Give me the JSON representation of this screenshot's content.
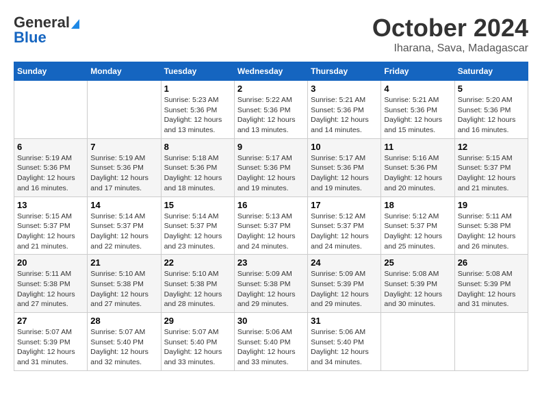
{
  "logo": {
    "line1": "General",
    "line2": "Blue"
  },
  "header": {
    "month": "October 2024",
    "location": "Iharana, Sava, Madagascar"
  },
  "weekdays": [
    "Sunday",
    "Monday",
    "Tuesday",
    "Wednesday",
    "Thursday",
    "Friday",
    "Saturday"
  ],
  "weeks": [
    [
      {
        "day": "",
        "info": ""
      },
      {
        "day": "",
        "info": ""
      },
      {
        "day": "1",
        "info": "Sunrise: 5:23 AM\nSunset: 5:36 PM\nDaylight: 12 hours and 13 minutes."
      },
      {
        "day": "2",
        "info": "Sunrise: 5:22 AM\nSunset: 5:36 PM\nDaylight: 12 hours and 13 minutes."
      },
      {
        "day": "3",
        "info": "Sunrise: 5:21 AM\nSunset: 5:36 PM\nDaylight: 12 hours and 14 minutes."
      },
      {
        "day": "4",
        "info": "Sunrise: 5:21 AM\nSunset: 5:36 PM\nDaylight: 12 hours and 15 minutes."
      },
      {
        "day": "5",
        "info": "Sunrise: 5:20 AM\nSunset: 5:36 PM\nDaylight: 12 hours and 16 minutes."
      }
    ],
    [
      {
        "day": "6",
        "info": "Sunrise: 5:19 AM\nSunset: 5:36 PM\nDaylight: 12 hours and 16 minutes."
      },
      {
        "day": "7",
        "info": "Sunrise: 5:19 AM\nSunset: 5:36 PM\nDaylight: 12 hours and 17 minutes."
      },
      {
        "day": "8",
        "info": "Sunrise: 5:18 AM\nSunset: 5:36 PM\nDaylight: 12 hours and 18 minutes."
      },
      {
        "day": "9",
        "info": "Sunrise: 5:17 AM\nSunset: 5:36 PM\nDaylight: 12 hours and 19 minutes."
      },
      {
        "day": "10",
        "info": "Sunrise: 5:17 AM\nSunset: 5:36 PM\nDaylight: 12 hours and 19 minutes."
      },
      {
        "day": "11",
        "info": "Sunrise: 5:16 AM\nSunset: 5:36 PM\nDaylight: 12 hours and 20 minutes."
      },
      {
        "day": "12",
        "info": "Sunrise: 5:15 AM\nSunset: 5:37 PM\nDaylight: 12 hours and 21 minutes."
      }
    ],
    [
      {
        "day": "13",
        "info": "Sunrise: 5:15 AM\nSunset: 5:37 PM\nDaylight: 12 hours and 21 minutes."
      },
      {
        "day": "14",
        "info": "Sunrise: 5:14 AM\nSunset: 5:37 PM\nDaylight: 12 hours and 22 minutes."
      },
      {
        "day": "15",
        "info": "Sunrise: 5:14 AM\nSunset: 5:37 PM\nDaylight: 12 hours and 23 minutes."
      },
      {
        "day": "16",
        "info": "Sunrise: 5:13 AM\nSunset: 5:37 PM\nDaylight: 12 hours and 24 minutes."
      },
      {
        "day": "17",
        "info": "Sunrise: 5:12 AM\nSunset: 5:37 PM\nDaylight: 12 hours and 24 minutes."
      },
      {
        "day": "18",
        "info": "Sunrise: 5:12 AM\nSunset: 5:37 PM\nDaylight: 12 hours and 25 minutes."
      },
      {
        "day": "19",
        "info": "Sunrise: 5:11 AM\nSunset: 5:38 PM\nDaylight: 12 hours and 26 minutes."
      }
    ],
    [
      {
        "day": "20",
        "info": "Sunrise: 5:11 AM\nSunset: 5:38 PM\nDaylight: 12 hours and 27 minutes."
      },
      {
        "day": "21",
        "info": "Sunrise: 5:10 AM\nSunset: 5:38 PM\nDaylight: 12 hours and 27 minutes."
      },
      {
        "day": "22",
        "info": "Sunrise: 5:10 AM\nSunset: 5:38 PM\nDaylight: 12 hours and 28 minutes."
      },
      {
        "day": "23",
        "info": "Sunrise: 5:09 AM\nSunset: 5:38 PM\nDaylight: 12 hours and 29 minutes."
      },
      {
        "day": "24",
        "info": "Sunrise: 5:09 AM\nSunset: 5:39 PM\nDaylight: 12 hours and 29 minutes."
      },
      {
        "day": "25",
        "info": "Sunrise: 5:08 AM\nSunset: 5:39 PM\nDaylight: 12 hours and 30 minutes."
      },
      {
        "day": "26",
        "info": "Sunrise: 5:08 AM\nSunset: 5:39 PM\nDaylight: 12 hours and 31 minutes."
      }
    ],
    [
      {
        "day": "27",
        "info": "Sunrise: 5:07 AM\nSunset: 5:39 PM\nDaylight: 12 hours and 31 minutes."
      },
      {
        "day": "28",
        "info": "Sunrise: 5:07 AM\nSunset: 5:40 PM\nDaylight: 12 hours and 32 minutes."
      },
      {
        "day": "29",
        "info": "Sunrise: 5:07 AM\nSunset: 5:40 PM\nDaylight: 12 hours and 33 minutes."
      },
      {
        "day": "30",
        "info": "Sunrise: 5:06 AM\nSunset: 5:40 PM\nDaylight: 12 hours and 33 minutes."
      },
      {
        "day": "31",
        "info": "Sunrise: 5:06 AM\nSunset: 5:40 PM\nDaylight: 12 hours and 34 minutes."
      },
      {
        "day": "",
        "info": ""
      },
      {
        "day": "",
        "info": ""
      }
    ]
  ]
}
